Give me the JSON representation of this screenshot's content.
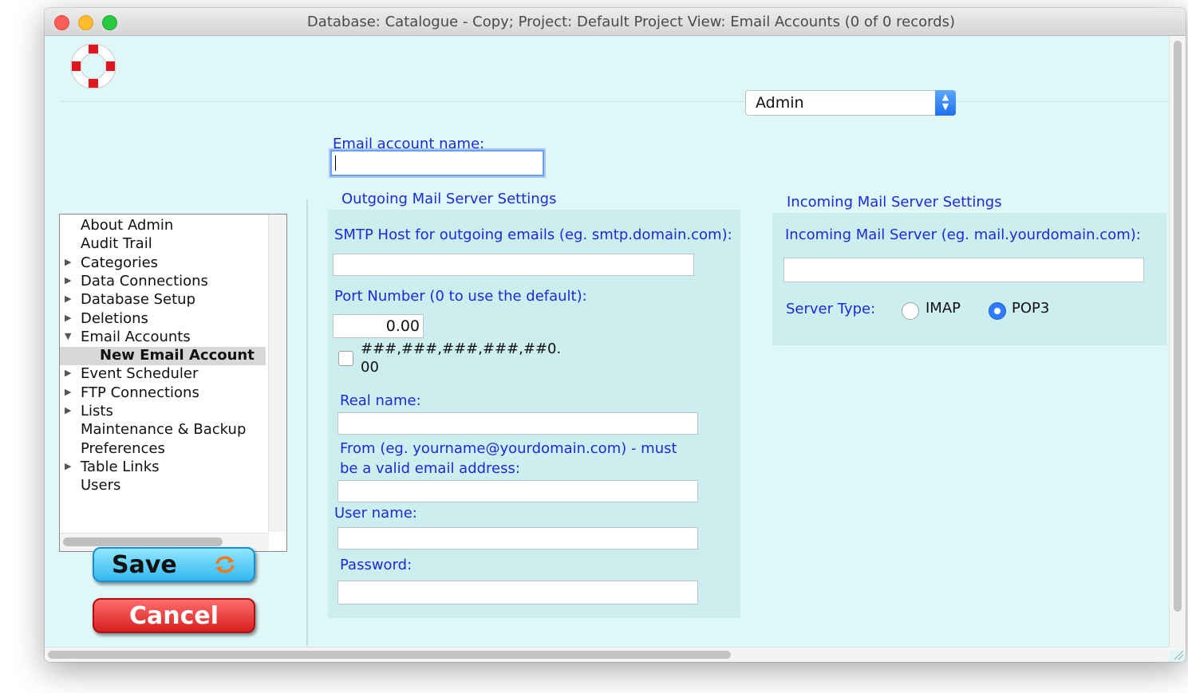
{
  "window": {
    "title": "Database: Catalogue - Copy; Project: Default Project    View: Email Accounts (0 of 0 records)"
  },
  "user_select": {
    "value": "Admin"
  },
  "form": {
    "email_account_name_label": "Email account name:",
    "email_account_name_value": "",
    "outgoing": {
      "heading": "Outgoing Mail Server Settings",
      "smtp_host_label": "SMTP Host for outgoing emails (eg. smtp.domain.com):",
      "smtp_host_value": "",
      "port_label": "Port Number (0 to use the default):",
      "port_value": "0.00",
      "format_line1": "###,###,###,###,##0.",
      "format_line2": "00",
      "real_name_label": "Real name:",
      "real_name_value": "",
      "from_label_line1": "From (eg. yourname@yourdomain.com) - must",
      "from_label_line2": "be a valid email address:",
      "from_value": "",
      "user_name_label": "User name:",
      "user_name_value": "",
      "password_label": "Password:",
      "password_value": ""
    },
    "incoming": {
      "heading": "Incoming Mail Server Settings",
      "server_label": "Incoming Mail Server (eg. mail.yourdomain.com):",
      "server_value": "",
      "server_type_label": "Server Type:",
      "imap_label": "IMAP",
      "pop3_label": "POP3",
      "selected_type": "POP3"
    }
  },
  "tree": {
    "items": [
      {
        "label": "About Admin",
        "expander": "",
        "selected": false
      },
      {
        "label": "Audit Trail",
        "expander": "",
        "selected": false
      },
      {
        "label": "Categories",
        "expander": "▶",
        "selected": false
      },
      {
        "label": "Data Connections",
        "expander": "▶",
        "selected": false
      },
      {
        "label": "Database Setup",
        "expander": "▶",
        "selected": false
      },
      {
        "label": "Deletions",
        "expander": "▶",
        "selected": false
      },
      {
        "label": "Email Accounts",
        "expander": "▼",
        "selected": false
      },
      {
        "label": "New Email Account",
        "expander": "",
        "selected": true,
        "child": true
      },
      {
        "label": "Event Scheduler",
        "expander": "▶",
        "selected": false
      },
      {
        "label": "FTP Connections",
        "expander": "▶",
        "selected": false
      },
      {
        "label": "Lists",
        "expander": "▶",
        "selected": false
      },
      {
        "label": "Maintenance & Backup",
        "expander": "",
        "selected": false
      },
      {
        "label": "Preferences",
        "expander": "",
        "selected": false
      },
      {
        "label": "Table Links",
        "expander": "▶",
        "selected": false
      },
      {
        "label": "Users",
        "expander": "",
        "selected": false
      }
    ]
  },
  "buttons": {
    "save_label": "Save",
    "cancel_label": "Cancel"
  },
  "colors": {
    "label_blue": "#1a2bd8",
    "background": "#dff7f7",
    "panel": "#cdeeee"
  }
}
